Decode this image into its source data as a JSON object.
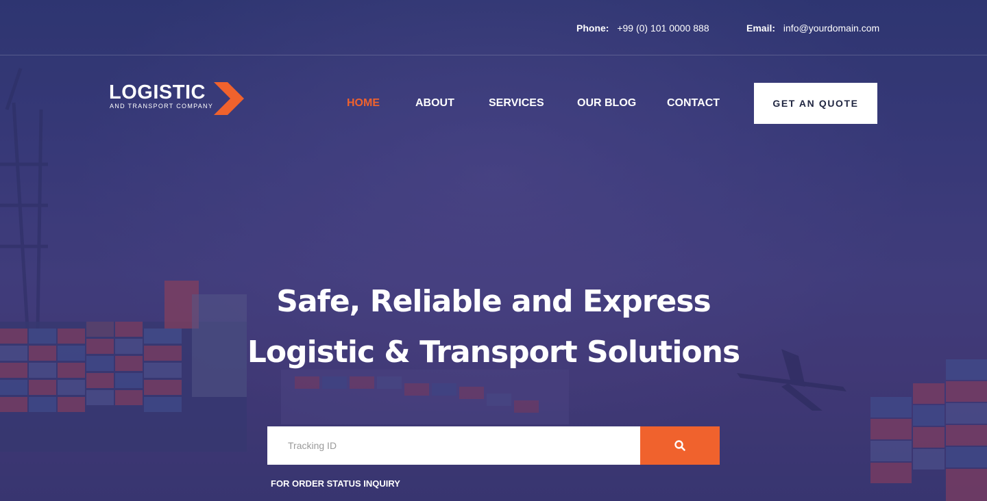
{
  "topbar": {
    "phone_label": "Phone:",
    "phone_value": "+99 (0) 101 0000 888",
    "email_label": "Email:",
    "email_value": "info@yourdomain.com"
  },
  "logo": {
    "word": "LOGISTIC",
    "tagline": "AND TRANSPORT COMPANY"
  },
  "nav": {
    "items": [
      {
        "label": "HOME",
        "active": true
      },
      {
        "label": "ABOUT"
      },
      {
        "label": "SERVICES"
      },
      {
        "label": "OUR BLOG"
      },
      {
        "label": "CONTACT"
      }
    ],
    "cta_label": "GET AN QUOTE"
  },
  "hero": {
    "headline_line1": "Safe, Reliable and Express",
    "headline_line2": "Logistic & Transport Solutions"
  },
  "tracking": {
    "placeholder": "Tracking ID",
    "search_icon": "search-icon",
    "caption": "FOR ORDER STATUS INQUIRY"
  },
  "colors": {
    "accent": "#f0622d",
    "background": "#3a3b73",
    "text": "#ffffff"
  }
}
